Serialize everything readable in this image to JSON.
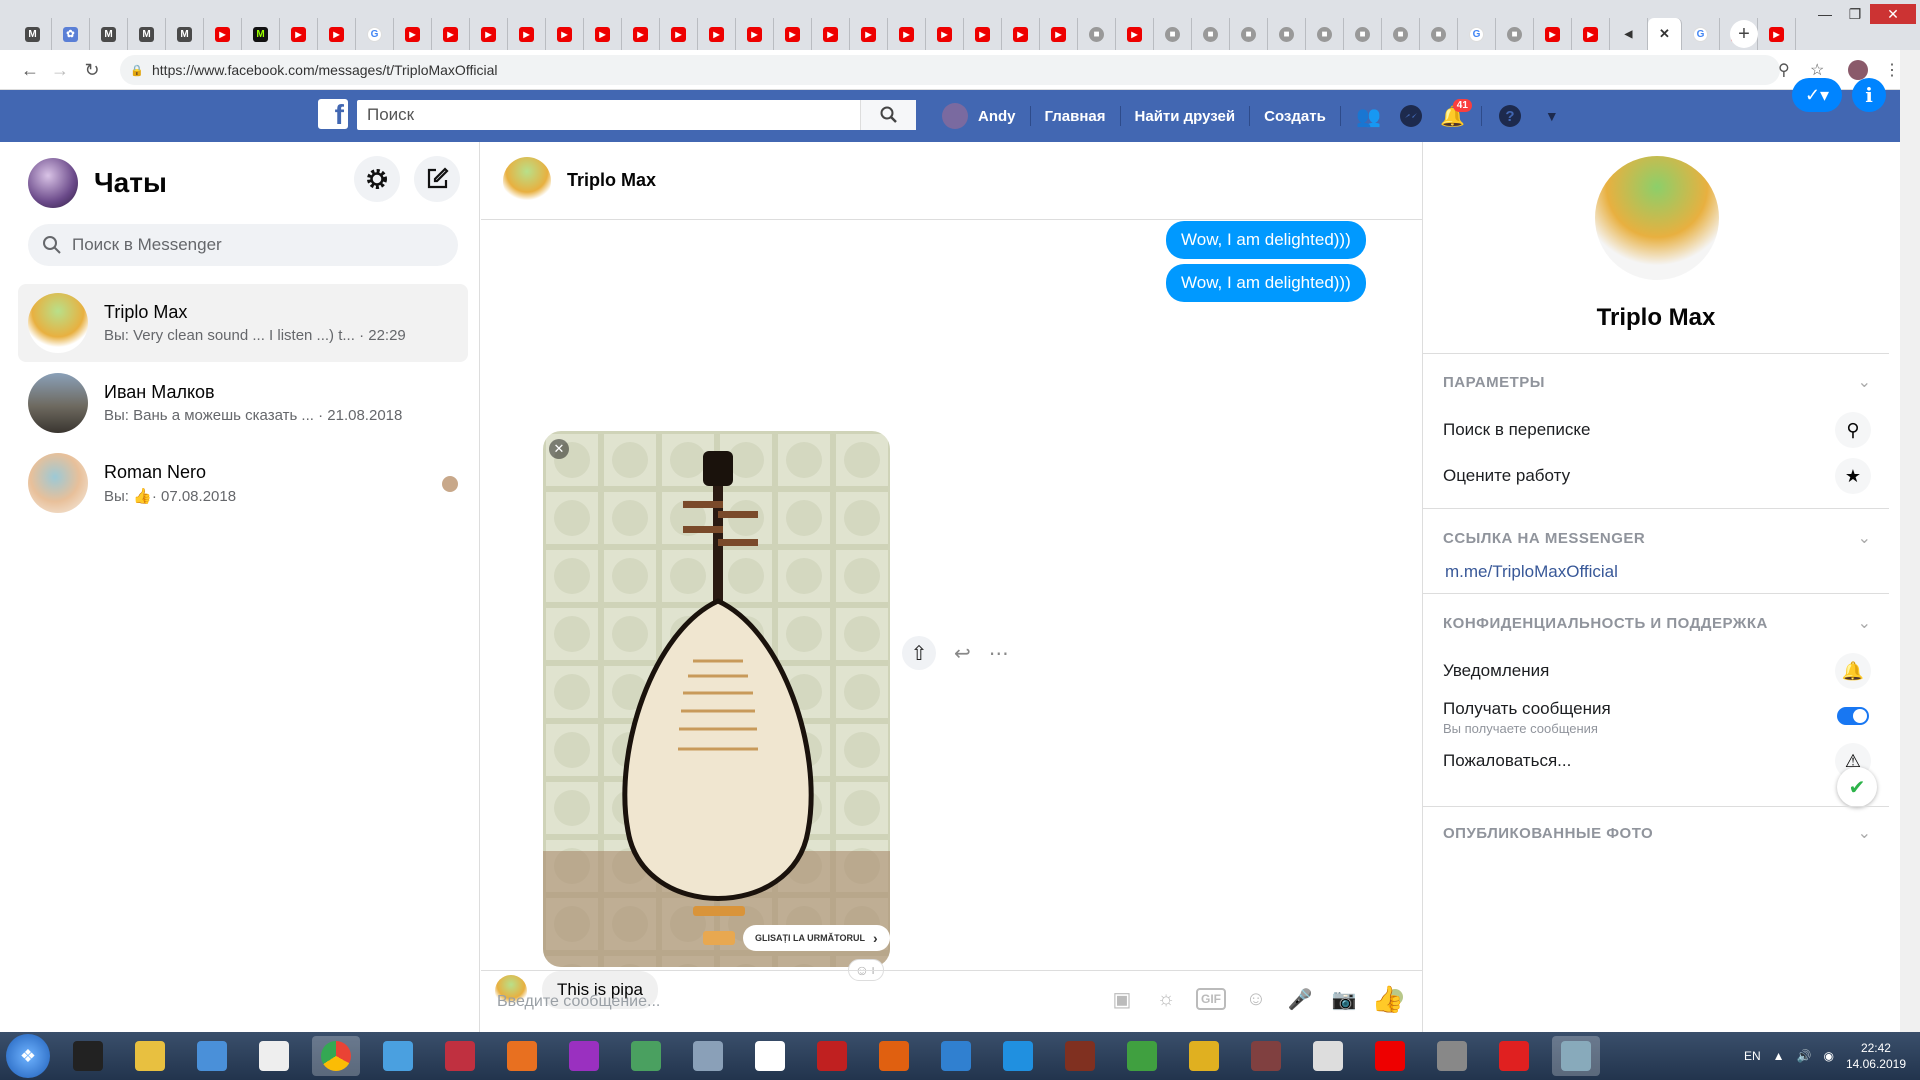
{
  "browser": {
    "tabs": [
      "M",
      "puzzle",
      "M",
      "M",
      "M",
      "yt",
      "M2",
      "yt",
      "yt",
      "G",
      "yt",
      "yt",
      "yt",
      "yt",
      "yt",
      "yt",
      "yt",
      "yt",
      "yt",
      "yt",
      "yt",
      "yt",
      "yt",
      "yt",
      "yt",
      "yt",
      "yt",
      "yt",
      "gr",
      "yt",
      "gr",
      "gr",
      "gr",
      "gr",
      "gr",
      "gr",
      "gr",
      "gr",
      "G",
      "gr",
      "yt",
      "yt",
      "vol",
      "close",
      "G",
      "yt",
      "yt"
    ],
    "url": "https://www.facebook.com/messages/t/TriploMaxOfficial",
    "new_tab": "+"
  },
  "fbbar": {
    "search_placeholder": "Поиск",
    "user": "Andy",
    "home": "Главная",
    "find_friends": "Найти друзей",
    "create": "Создать",
    "notif_count": "41"
  },
  "left": {
    "title": "Чаты",
    "search_placeholder": "Поиск в Messenger",
    "chats": [
      {
        "name": "Triplo Max",
        "preview": "Вы: Very clean sound ... I listen ...) t...",
        "time": "· 22:29"
      },
      {
        "name": "Иван Малков",
        "preview": "Вы: Вань а можешь сказать ...",
        "time": "· 21.08.2018"
      },
      {
        "name": "Roman Nero",
        "preview": "Вы:",
        "time": "· 07.08.2018"
      }
    ]
  },
  "conversation": {
    "name": "Triplo Max",
    "messages_out": [
      "Wow, I am delighted)))",
      "Wow, I am delighted)))"
    ],
    "photo_caption": "GLISAȚI LA URMĂTORUL",
    "message_in": "This is pipa",
    "compose_placeholder": "Введите сообщение..."
  },
  "info": {
    "name": "Triplo Max",
    "params_header": "ПАРАМЕТРЫ",
    "search_in_chat": "Поиск в переписке",
    "rate": "Оцените работу",
    "link_header": "ССЫЛКА НА MESSENGER",
    "link": "m.me/TriploMaxOfficial",
    "privacy_header": "КОНФИДЕНЦИАЛЬНОСТЬ И ПОДДЕРЖКА",
    "notifications": "Уведомления",
    "receive": "Получать сообщения",
    "receive_sub": "Вы получаете сообщения",
    "report": "Пожаловаться...",
    "photos_header": "ОПУБЛИКОВАННЫЕ ФОТО"
  },
  "taskbar": {
    "lang": "EN",
    "time": "22:42",
    "date": "14.06.2019"
  },
  "colors": {
    "fb_blue": "#4267b2",
    "messenger_blue": "#0099ff"
  }
}
